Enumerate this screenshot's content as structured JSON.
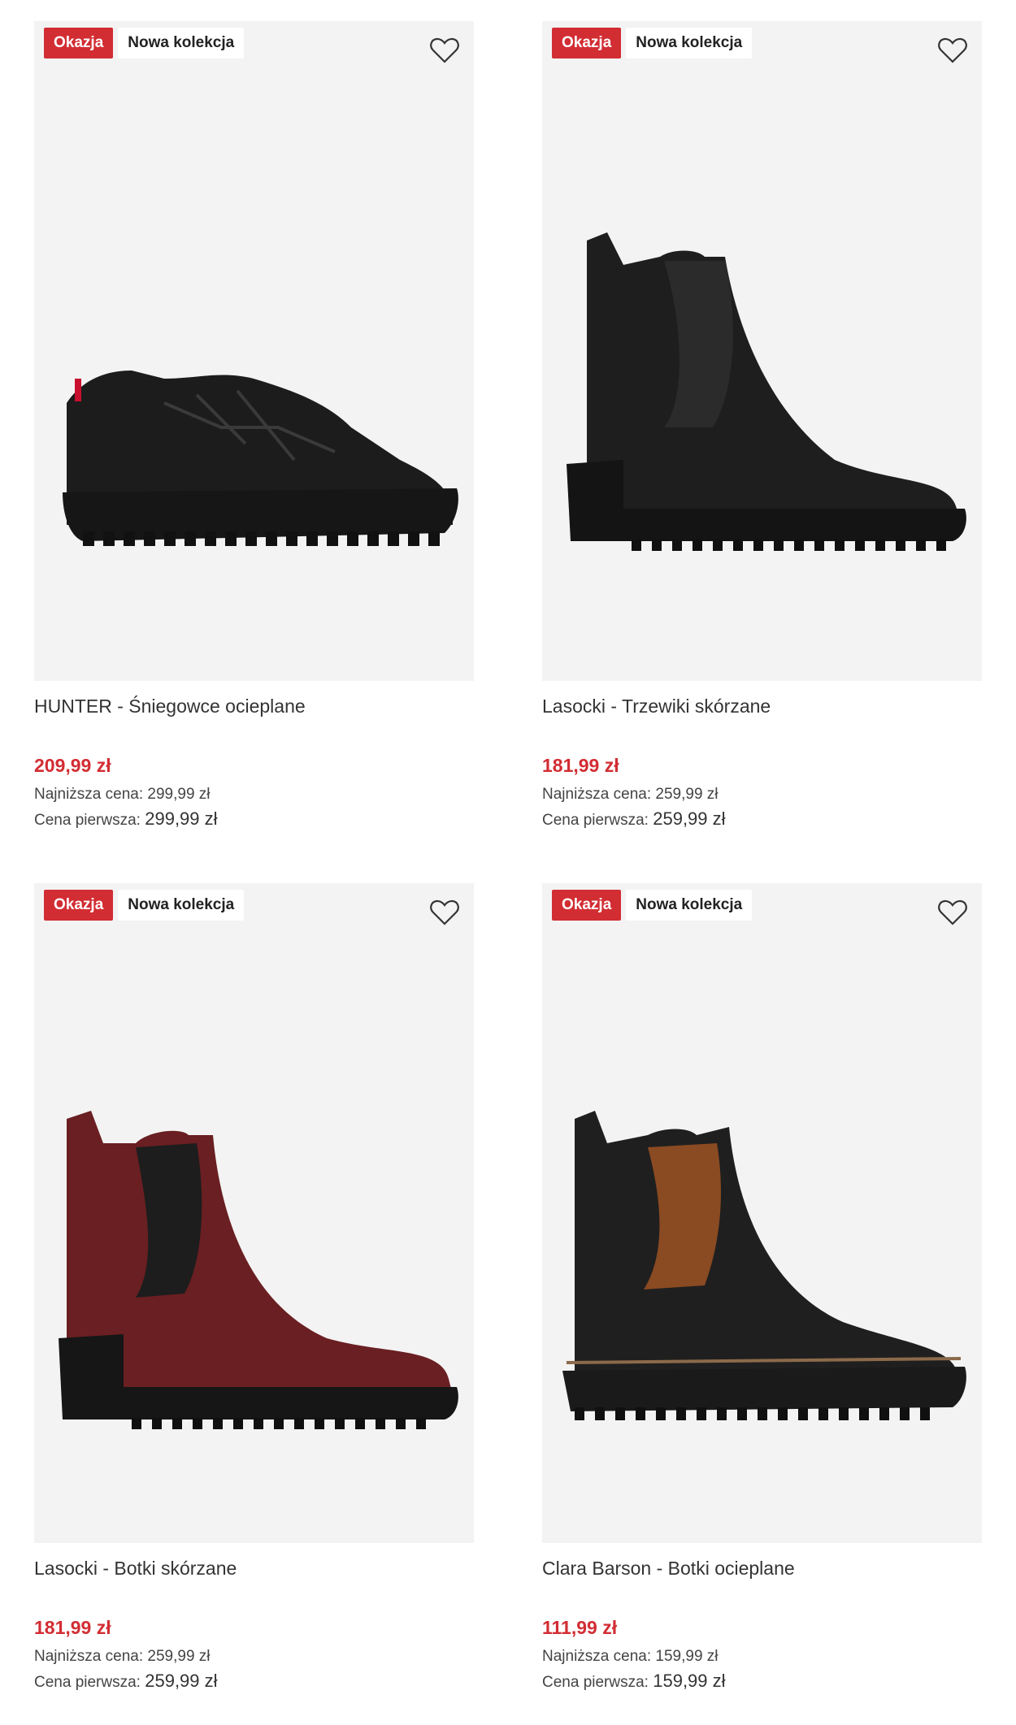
{
  "products": [
    {
      "badges": {
        "sale": "Okazja",
        "new": "Nowa kolekcja"
      },
      "name": "HUNTER - Śniegowce ocieplane",
      "price": "209,99 zł",
      "lowest_label": "Najniższa cena:",
      "lowest_value": "299,99 zł",
      "original_label": "Cena pierwsza:",
      "original_value": "299,99 zł",
      "colors": {
        "upper": "#1c1c1c",
        "sole": "#161616",
        "accent": "#c8102e"
      }
    },
    {
      "badges": {
        "sale": "Okazja",
        "new": "Nowa kolekcja"
      },
      "name": "Lasocki - Trzewiki skórzane",
      "price": "181,99 zł",
      "lowest_label": "Najniższa cena:",
      "lowest_value": "259,99 zł",
      "original_label": "Cena pierwsza:",
      "original_value": "259,99 zł",
      "colors": {
        "upper": "#1e1e1e",
        "sole": "#141414",
        "elastic": "#2b2b2b"
      }
    },
    {
      "badges": {
        "sale": "Okazja",
        "new": "Nowa kolekcja"
      },
      "name": "Lasocki - Botki skórzane",
      "price": "181,99 zł",
      "lowest_label": "Najniższa cena:",
      "lowest_value": "259,99 zł",
      "original_label": "Cena pierwsza:",
      "original_value": "259,99 zł",
      "colors": {
        "upper": "#6a1f22",
        "sole": "#161616",
        "elastic": "#1d1d1d"
      }
    },
    {
      "badges": {
        "sale": "Okazja",
        "new": "Nowa kolekcja"
      },
      "name": "Clara Barson - Botki ocieplane",
      "price": "111,99 zł",
      "lowest_label": "Najniższa cena:",
      "lowest_value": "159,99 zł",
      "original_label": "Cena pierwsza:",
      "original_value": "159,99 zł",
      "colors": {
        "upper": "#1f1f1f",
        "sole": "#1a1a1a",
        "elastic": "#8a4a22"
      }
    }
  ],
  "theme": {
    "sale_color": "#d22d33",
    "image_bg": "#f3f3f3"
  }
}
